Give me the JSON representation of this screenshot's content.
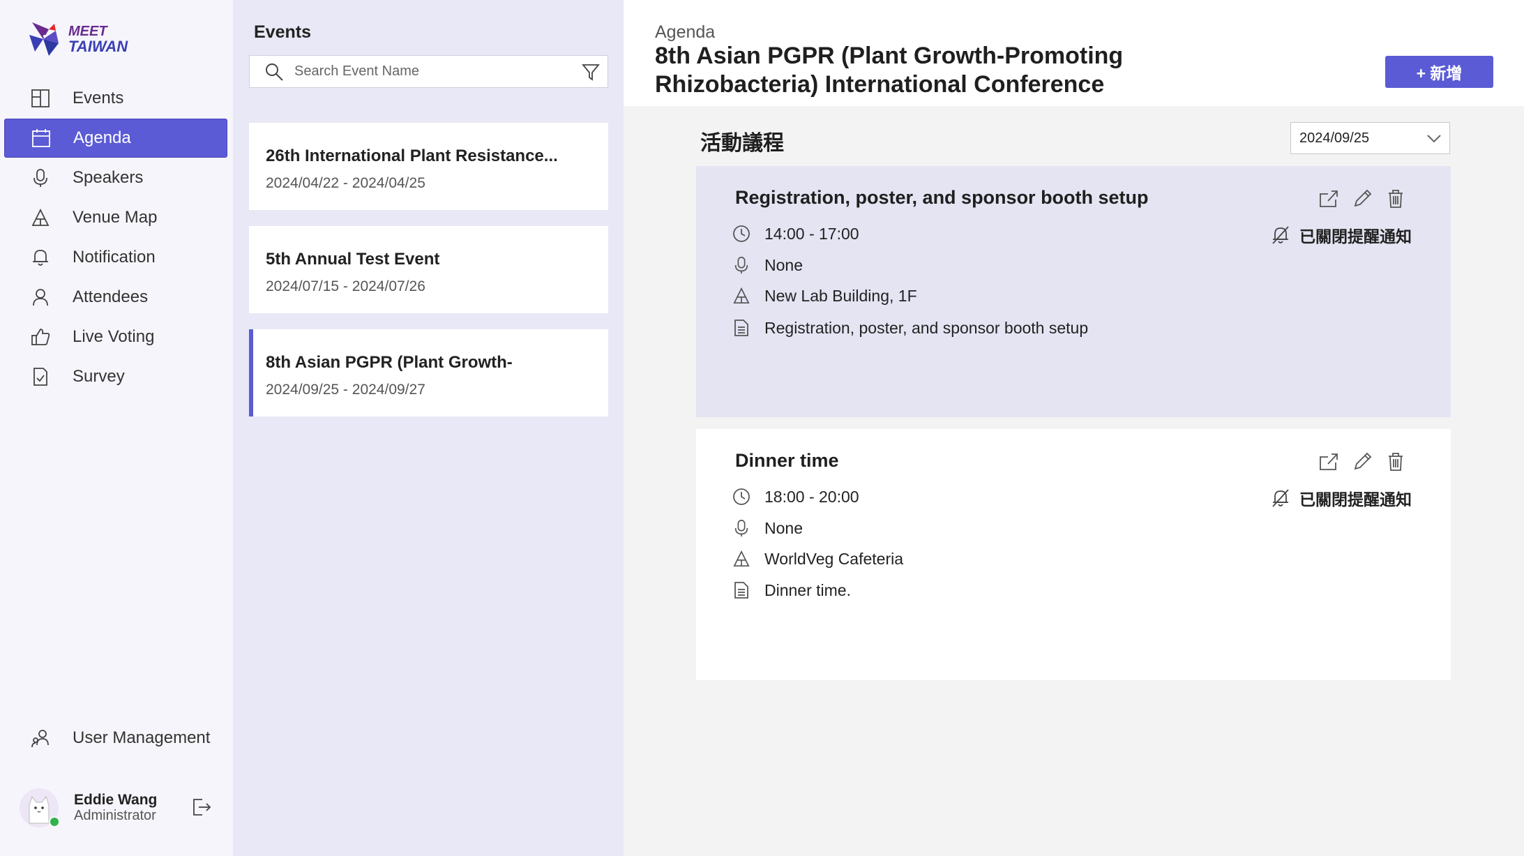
{
  "brand": {
    "line1": "MEET",
    "line2": "TAIWAN"
  },
  "sidebar": {
    "items": [
      {
        "label": "Events",
        "icon": "events-icon"
      },
      {
        "label": "Agenda",
        "icon": "calendar-icon",
        "active": true
      },
      {
        "label": "Speakers",
        "icon": "microphone-icon"
      },
      {
        "label": "Venue Map",
        "icon": "venue-map-icon"
      },
      {
        "label": "Notification",
        "icon": "bell-icon"
      },
      {
        "label": "Attendees",
        "icon": "person-icon"
      },
      {
        "label": "Live Voting",
        "icon": "thumbs-up-icon"
      },
      {
        "label": "Survey",
        "icon": "survey-icon"
      }
    ],
    "bottom_item": {
      "label": "User Management",
      "icon": "users-icon"
    },
    "user": {
      "name": "Eddie Wang",
      "role": "Administrator",
      "status": "online"
    }
  },
  "events_panel": {
    "title": "Events",
    "search_placeholder": "Search Event Name",
    "events": [
      {
        "name": "26th International Plant Resistance...",
        "dates": "2024/04/22 - 2024/04/25"
      },
      {
        "name": "5th Annual Test Event",
        "dates": "2024/07/15 - 2024/07/26"
      },
      {
        "name": "8th Asian PGPR (Plant Growth-",
        "dates": "2024/09/25 - 2024/09/27",
        "selected": true
      }
    ]
  },
  "main": {
    "breadcrumb": "Agenda",
    "title": "8th Asian PGPR (Plant Growth-Promoting Rhizobacteria) International Conference",
    "add_button": "+ 新增",
    "section_title": "活動議程",
    "selected_date": "2024/09/25",
    "agenda": [
      {
        "title": "Registration, poster, and sponsor booth setup",
        "time": "14:00 - 17:00",
        "speaker": "None",
        "location": "New Lab Building, 1F",
        "description": "Registration, poster, and sponsor booth setup",
        "notification": "已關閉提醒通知"
      },
      {
        "title": "Dinner time",
        "time": "18:00 - 20:00",
        "speaker": "None",
        "location": "WorldVeg Cafeteria",
        "description": "Dinner time.",
        "notification": "已關閉提醒通知"
      }
    ]
  },
  "colors": {
    "accent": "#5b5bd6",
    "sidebar_bg": "#f6f5fb",
    "events_bg": "#e8e8f6",
    "card_highlight": "#e4e4f3",
    "online": "#2fb34a"
  }
}
